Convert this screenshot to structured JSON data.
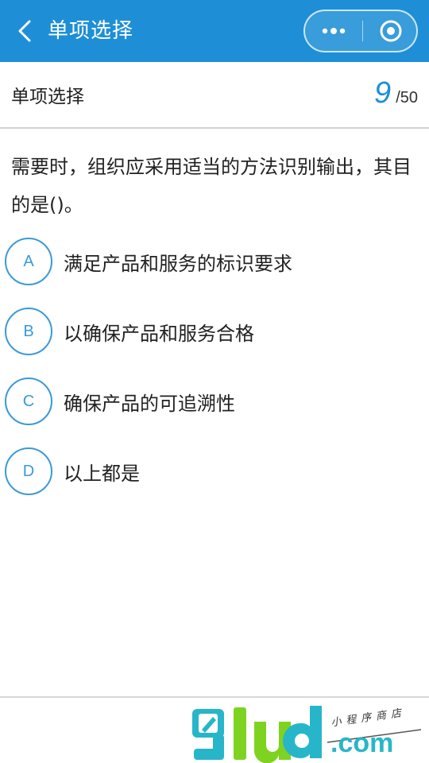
{
  "navbar": {
    "title": "单项选择",
    "back_icon": "chevron-left-icon",
    "more_icon": "more-dots-icon",
    "close_icon": "target-circle-icon",
    "color": "#1e8fd6"
  },
  "header": {
    "title": "单项选择",
    "current": "9",
    "total": "/50"
  },
  "question": {
    "text": "需要时，组织应采用适当的方法识别输出，其目的是()。"
  },
  "options": [
    {
      "letter": "A",
      "text": "满足产品和服务的标识要求"
    },
    {
      "letter": "B",
      "text": "以确保产品和服务合格"
    },
    {
      "letter": "C",
      "text": "确保产品的可追溯性"
    },
    {
      "letter": "D",
      "text": "以上都是"
    }
  ],
  "watermark": {
    "brand": "lud",
    "domain": ".com",
    "tagline": "小程序商店"
  },
  "colors": {
    "accent": "#1e8fd6",
    "option_border": "#3a9ad8",
    "watermark_green": "#7ed321",
    "watermark_teal": "#27b6c9"
  }
}
